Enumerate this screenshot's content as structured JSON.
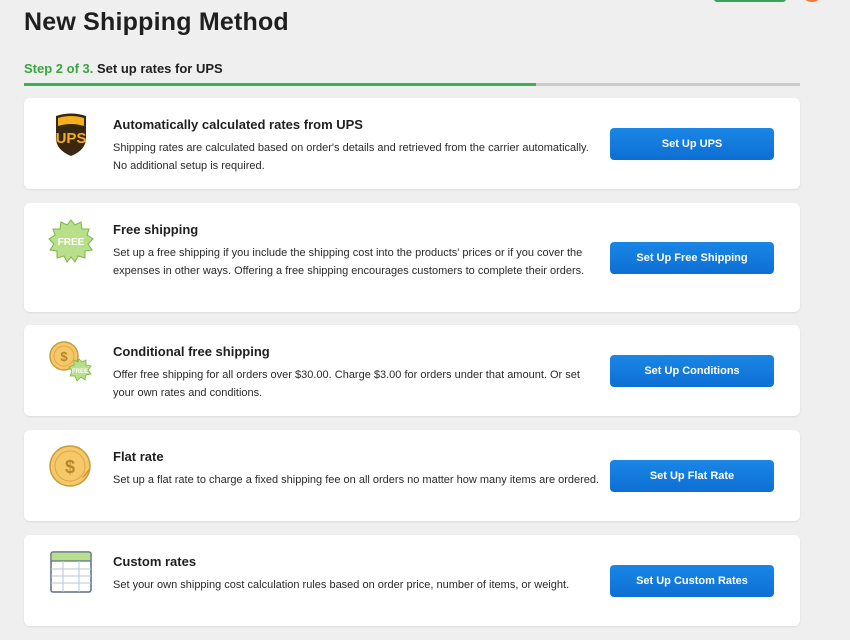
{
  "page": {
    "title": "New Shipping Method"
  },
  "step": {
    "number": "Step 2 of 3.",
    "description": "Set up rates for UPS",
    "progress": 0.66
  },
  "methods": [
    {
      "icon": "ups-logo-icon",
      "title": "Automatically calculated rates from UPS",
      "description": "Shipping rates are calculated based on order's details and retrieved from the carrier automatically. No additional setup is required.",
      "button": "Set Up UPS"
    },
    {
      "icon": "free-badge-icon",
      "icon_text": "FREE",
      "title": "Free shipping",
      "description": "Set up a free shipping if you include the shipping cost into the products' prices or if you cover the expenses in other ways. Offering a free shipping encourages customers to complete their orders.",
      "button": "Set Up Free Shipping"
    },
    {
      "icon": "coin-free-badge-icon",
      "icon_text": "FREE",
      "title": "Conditional free shipping",
      "description": "Offer free shipping for all orders over $30.00. Charge $3.00 for orders under that amount. Or set your own rates and conditions.",
      "button": "Set Up Conditions"
    },
    {
      "icon": "coin-sticker-icon",
      "title": "Flat rate",
      "description": "Set up a flat rate to charge a fixed shipping fee on all orders no matter how many items are ordered.",
      "button": "Set Up Flat Rate"
    },
    {
      "icon": "spreadsheet-icon",
      "title": "Custom rates",
      "description": "Set your own shipping cost calculation rules based on order price, number of items, or weight.",
      "button": "Set Up Custom Rates"
    }
  ],
  "colors": {
    "accent": "#0d6fd3",
    "step": "#3aa540",
    "progress": "#3bb34a",
    "background": "#efeff0"
  }
}
